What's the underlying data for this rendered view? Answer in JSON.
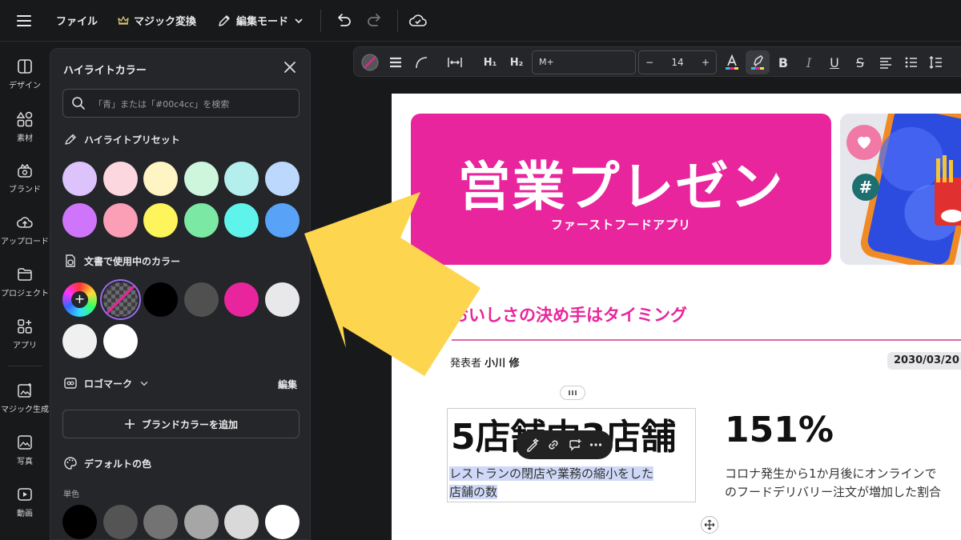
{
  "topbar": {
    "file_label": "ファイル",
    "magic_label": "マジック変換",
    "edit_mode_label": "編集モード"
  },
  "rail": {
    "items": [
      {
        "label": "デザイン",
        "icon": "design-icon"
      },
      {
        "label": "素材",
        "icon": "elements-icon"
      },
      {
        "label": "ブランド",
        "icon": "brand-icon"
      },
      {
        "label": "アップロード",
        "icon": "upload-icon"
      },
      {
        "label": "プロジェクト",
        "icon": "folder-icon"
      },
      {
        "label": "アプリ",
        "icon": "apps-icon"
      },
      {
        "label": "マジック生成",
        "icon": "magic-generate-icon"
      },
      {
        "label": "写真",
        "icon": "photo-icon"
      },
      {
        "label": "動画",
        "icon": "video-icon"
      }
    ]
  },
  "panel": {
    "title": "ハイライトカラー",
    "search_placeholder": "「青」または「#00c4cc」を検索",
    "preset_heading": "ハイライトプリセット",
    "preset_colors": [
      "#dcc3fb",
      "#fdd7df",
      "#fff4c4",
      "#cdf6dd",
      "#b5efed",
      "#bcd9fd",
      "#cf75fb",
      "#fb9fb6",
      "#fdf55b",
      "#7be9a3",
      "#5ef4ec",
      "#58a3f7"
    ],
    "doc_heading": "文書で使用中のカラー",
    "doc_colors": [
      "rainbow",
      "transparent",
      "#000000",
      "#505050",
      "#e8259c",
      "#e8e8ea",
      "#f0f0f0",
      "#ffffff"
    ],
    "logo_heading": "ロゴマーク",
    "edit_label": "編集",
    "add_brand_label": "ブランドカラーを追加",
    "default_heading": "デフォルトの色",
    "solid_label": "単色",
    "default_colors": [
      "#000000",
      "#545454",
      "#737373",
      "#a6a6a6",
      "#d9d9d9",
      "#ffffff"
    ]
  },
  "format_bar": {
    "h1": "H₁",
    "h2": "H₂",
    "font": "M+",
    "font_size": "14",
    "minus": "−",
    "plus": "+",
    "bold": "B",
    "italic": "I",
    "underline": "U",
    "strike": "S"
  },
  "document": {
    "banner_title": "営業プレゼン",
    "banner_subtitle": "ファーストフードアプリ",
    "headline": "おいしさの決め手はタイミング",
    "presenter_prefix": "発表者",
    "presenter_name": "小川 修",
    "date": "2030/03/20",
    "stat1_value": "5店舗中3店舗",
    "stat1_desc_line1": "レストランの閉店や業務の縮小をした",
    "stat1_desc_line2": "店舗の数",
    "stat2_value": "151%",
    "stat2_desc_line1": "コロナ発生から1か月後にオンラインで",
    "stat2_desc_line2": "のフードデリバリー注文が増加した割合"
  }
}
